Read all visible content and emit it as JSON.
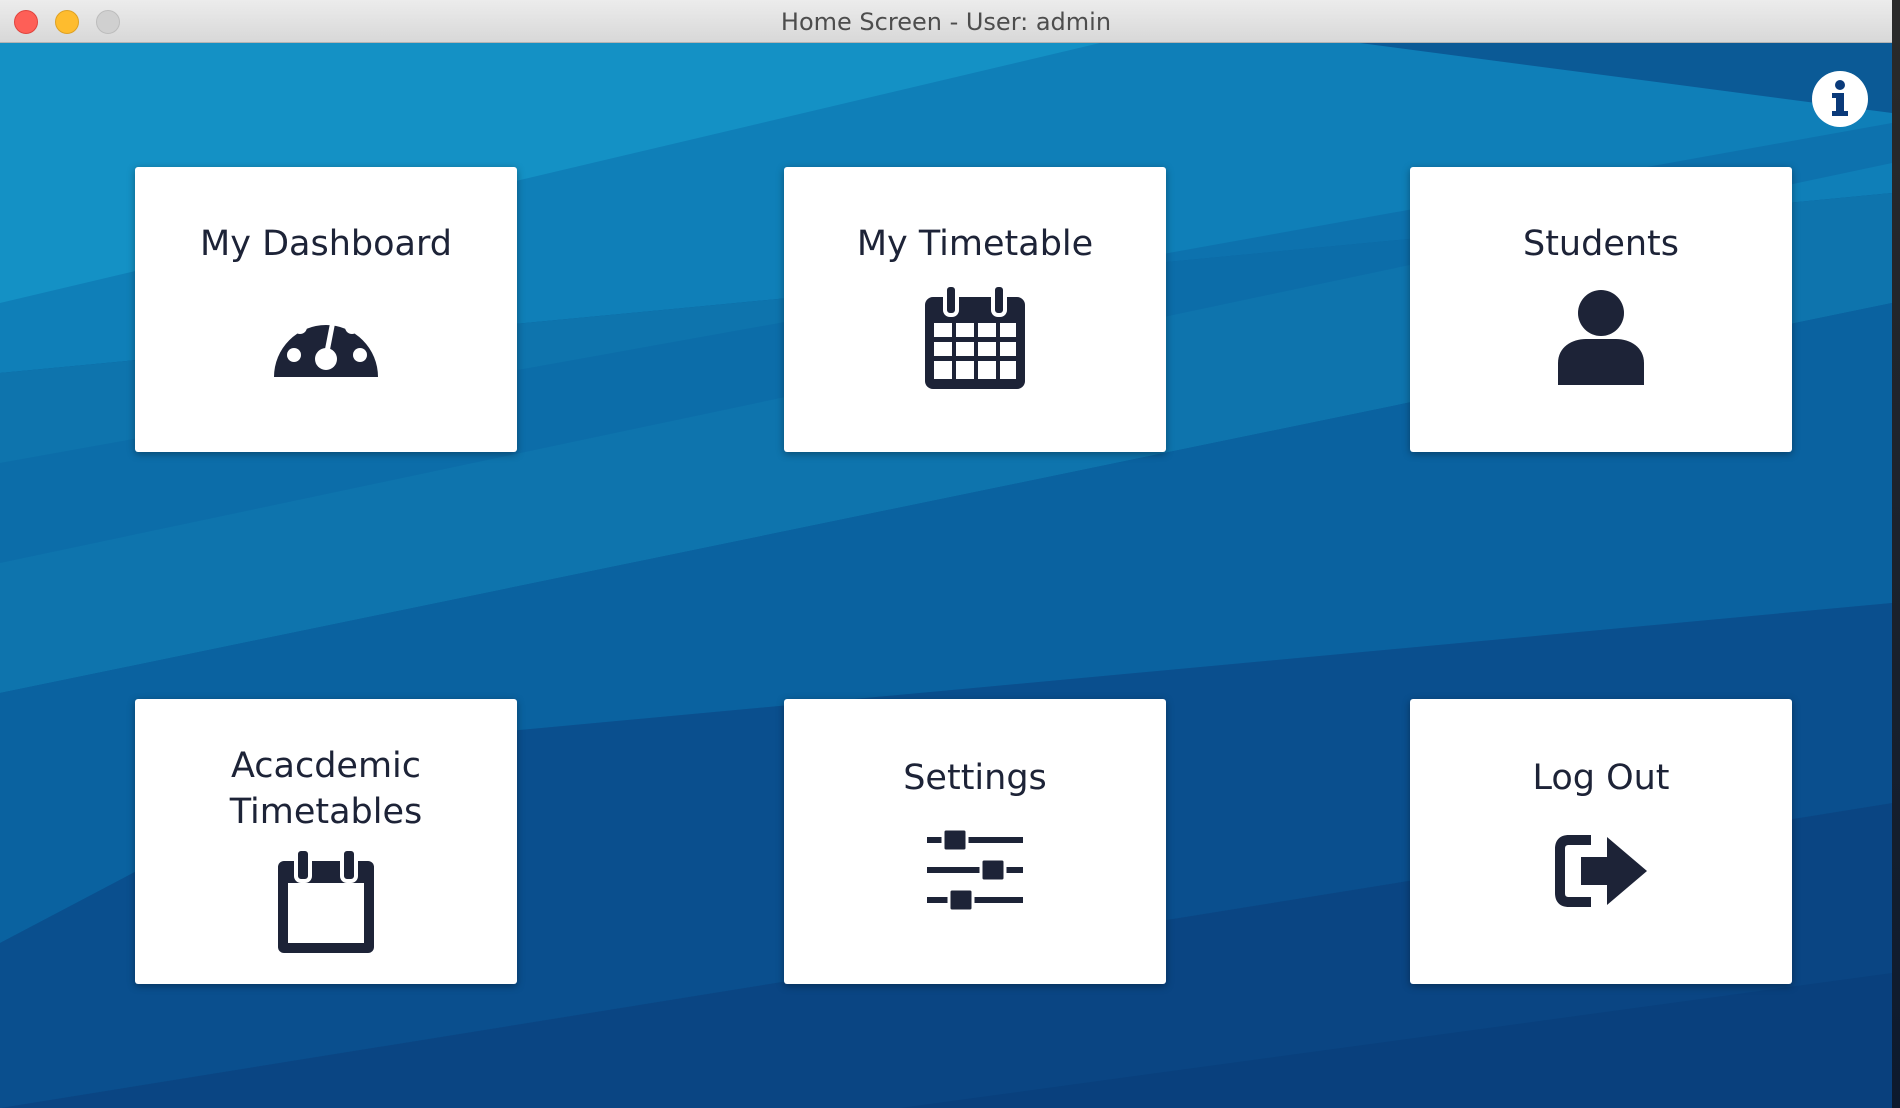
{
  "window": {
    "title": "Home Screen - User: admin"
  },
  "colors": {
    "icon": "#1d2337",
    "tile_bg": "#ffffff",
    "background_dark": "#0a4a8a",
    "background_light": "#1497c9"
  },
  "tiles": [
    {
      "label": "My Dashboard",
      "icon": "dashboard-icon"
    },
    {
      "label": "My Timetable",
      "icon": "calendar-grid-icon"
    },
    {
      "label": "Students",
      "icon": "user-icon"
    },
    {
      "label": "Acacdemic Timetables",
      "line1": "Acacdemic",
      "line2": "Timetables",
      "icon": "calendar-empty-icon"
    },
    {
      "label": "Settings",
      "icon": "sliders-icon"
    },
    {
      "label": "Log Out",
      "icon": "logout-icon"
    }
  ],
  "info_button": {
    "icon": "info-icon"
  }
}
